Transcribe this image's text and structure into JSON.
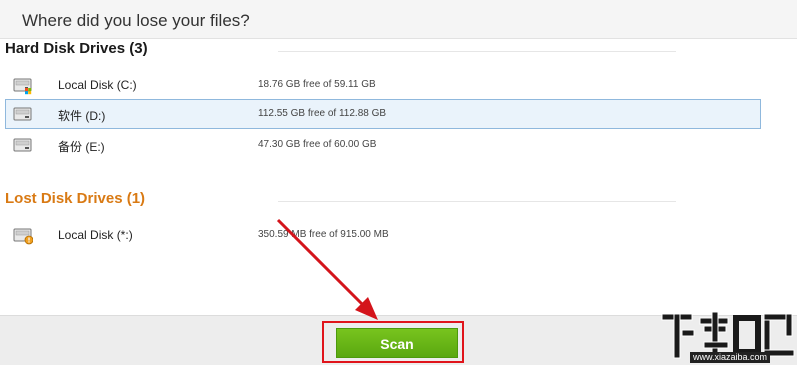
{
  "header": {
    "title": "Where did you lose your files?"
  },
  "hard_disk": {
    "title": "Hard Disk Drives (3)",
    "drives": [
      {
        "name": "Local Disk (C:)",
        "free": "18.76 GB free of 59.11 GB",
        "icon": "windows-drive-icon"
      },
      {
        "name": "软件 (D:)",
        "free": "112.55 GB free of 112.88 GB",
        "icon": "drive-icon"
      },
      {
        "name": "备份 (E:)",
        "free": "47.30 GB free of 60.00 GB",
        "icon": "drive-icon"
      }
    ]
  },
  "lost_disk": {
    "title": "Lost Disk Drives (1)",
    "drives": [
      {
        "name": "Local Disk (*:)",
        "free": "350.59 MB free of 915.00 MB",
        "icon": "lost-drive-icon"
      }
    ]
  },
  "footer": {
    "scan_label": "Scan"
  },
  "watermark": {
    "url": "www.xiazaiba.com"
  },
  "colors": {
    "lost_title": "#d97a14",
    "selected_bg": "#eaf3fb",
    "scan_button": "#6bb81a",
    "highlight": "#e0141b"
  }
}
